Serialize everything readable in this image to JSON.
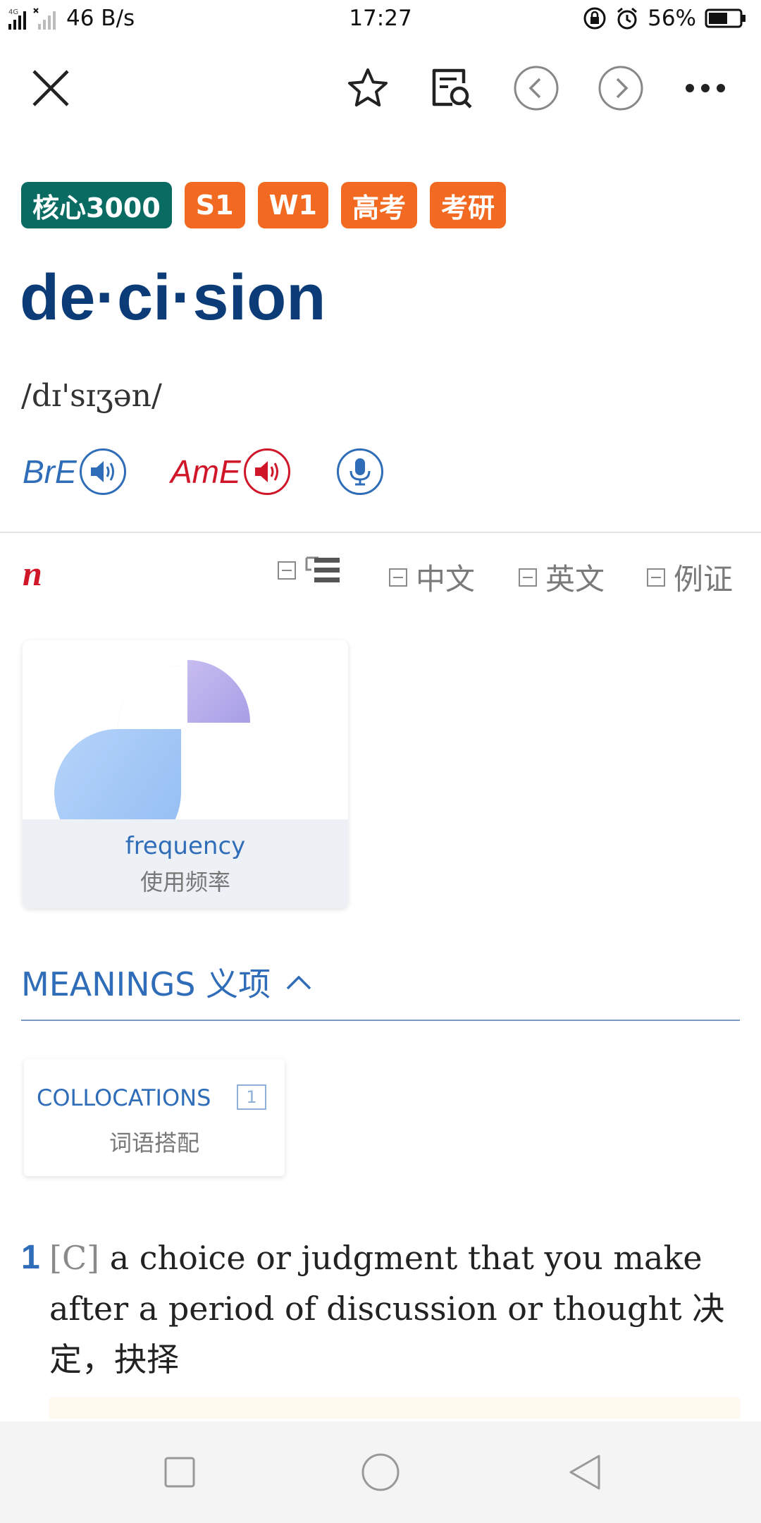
{
  "status_bar": {
    "network": "4G",
    "speed": "46 B/s",
    "time": "17:27",
    "battery": "56%"
  },
  "toolbar": {
    "icons": [
      "close-icon",
      "star-icon",
      "search-note-icon",
      "chevron-left-icon",
      "chevron-right-icon",
      "more-icon"
    ]
  },
  "tags": [
    "核心3000",
    "S1",
    "W1",
    "高考",
    "考研"
  ],
  "entry": {
    "headword": "de·ci·sion",
    "pronunciation": "/dɪ'sɪʒən/"
  },
  "audio": {
    "bre_label": "BrE",
    "ame_label": "AmE"
  },
  "pos": {
    "label": "n",
    "filters": [
      "中文",
      "英文",
      "例证"
    ]
  },
  "frequency": {
    "title_en": "frequency",
    "title_cn": "使用频率"
  },
  "meanings": {
    "title": "MEANINGS 义项"
  },
  "collocations": {
    "title_en": "COLLOCATIONS",
    "count": "1",
    "title_cn": "词语搭配"
  },
  "senses": [
    {
      "number": "1",
      "grammar": "[C]",
      "definition": "a choice or judgment that you make after a period of discussion or thought 决定，抉择"
    }
  ],
  "colors": {
    "headword": "#0c3c78",
    "accent_blue": "#2f6db8",
    "core_tag": "#0a6b63",
    "orange_tag": "#f26a21",
    "pos_red": "#d0172a"
  }
}
